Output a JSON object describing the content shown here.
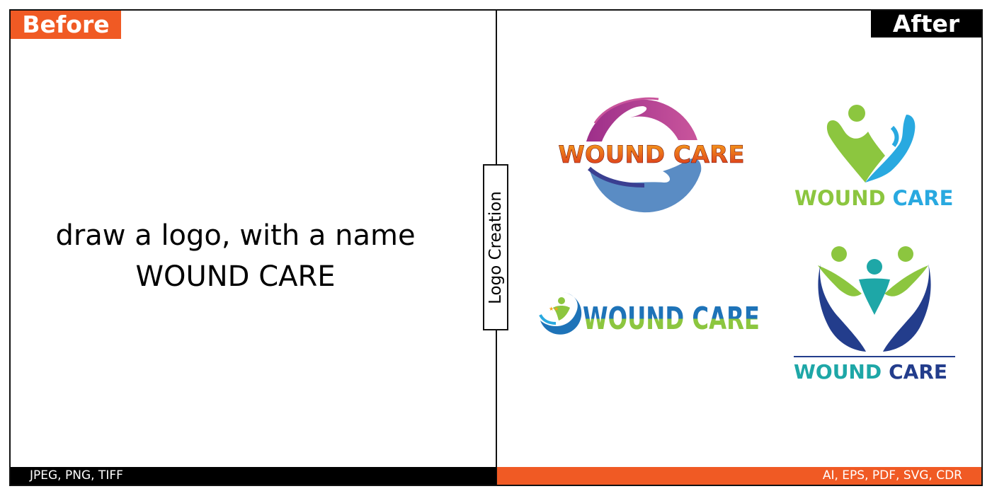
{
  "labels": {
    "before": "Before",
    "after": "After"
  },
  "request": {
    "line1": "draw a logo, with a name",
    "line2": "WOUND CARE"
  },
  "center_tab": "Logo Creation",
  "footer": {
    "left_formats": "JPEG, PNG, TIFF",
    "right_formats": "AI, EPS, PDF, SVG, CDR"
  },
  "logos": [
    {
      "id": "logo-1",
      "wordmark": "WOUND CARE"
    },
    {
      "id": "logo-2",
      "wordmark_part1": "WOUND",
      "wordmark_part2": "CARE"
    },
    {
      "id": "logo-3",
      "wordmark": "WOUND CARE"
    },
    {
      "id": "logo-4",
      "wordmark_part1": "WOUND",
      "wordmark_part2": "CARE"
    }
  ],
  "colors": {
    "orange": "#f05a24",
    "black": "#000000",
    "magenta": "#c2509a",
    "blue": "#5a8cc4",
    "navy": "#3a3f91",
    "green": "#8cc63f",
    "sky": "#29a9e0",
    "teal": "#1ea7a7",
    "darkblue": "#233d8c"
  }
}
